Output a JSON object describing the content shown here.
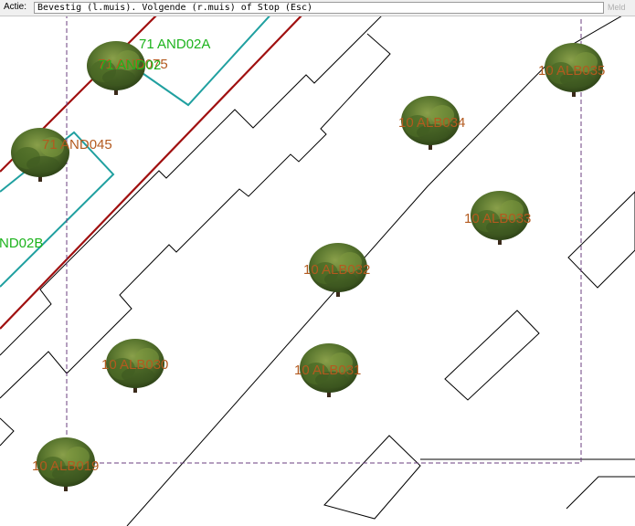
{
  "command_bar": {
    "label": "Actie:",
    "prompt": "Bevestig (l.muis). Volgende (r.muis) of Stop (Esc)",
    "extra": "Meld"
  },
  "map": {
    "colors": {
      "lines": "#000000",
      "road_red": "#a01010",
      "parcel_teal": "#20a0a0",
      "selection_purple": "#6b3f7f",
      "label_orange": "#b35a1f",
      "label_green": "#1db31d",
      "tree_foliage": "#4f6b2a"
    },
    "tree_labels": [
      "71 AND075",
      "71 AND045",
      "10 ALB035",
      "10 ALB034",
      "10 ALB033",
      "10 ALB032",
      "10 ALB030",
      "10 ALB031",
      "10 ALB019"
    ],
    "parcel_labels": [
      "71 AND02A",
      "71 AND02",
      "ND02B"
    ]
  }
}
